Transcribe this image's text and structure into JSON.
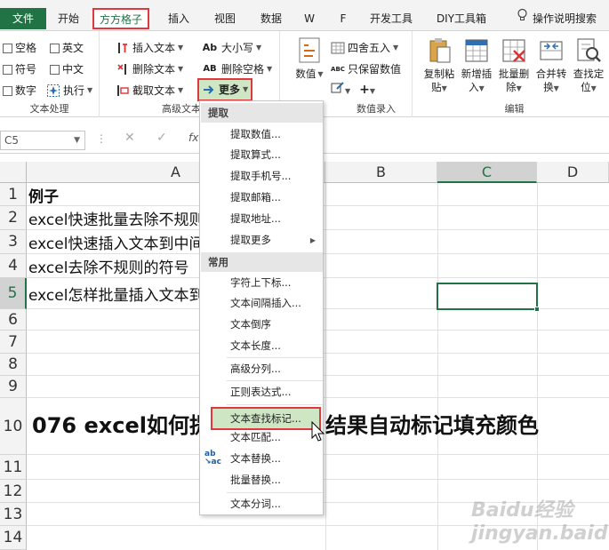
{
  "tabs": [
    "文件",
    "开始",
    "方方格子",
    "插入",
    "视图",
    "数据",
    "W",
    "F",
    "开发工具",
    "DIY工具箱"
  ],
  "tell_me": "操作说明搜索",
  "ribbon": {
    "text_group": {
      "label": "文本处理",
      "items": [
        "空格",
        "英文",
        "符号",
        "中文",
        "数字",
        "执行"
      ]
    },
    "advanced_group": {
      "label": "高级文本",
      "items": [
        "插入文本",
        "删除文本",
        "截取文本",
        "大小写",
        "删除空格",
        "更多"
      ],
      "icons": [
        "Ab",
        "AB"
      ]
    },
    "numeric_group": {
      "label": "数值录入",
      "big_label": "数值",
      "items": [
        "四舍五入",
        "只保留数值"
      ],
      "icon": "ABC"
    },
    "edit_group": {
      "label": "编辑",
      "buttons": [
        {
          "top": "复制粘",
          "bottom": "贴"
        },
        {
          "top": "新增插",
          "bottom": "入"
        },
        {
          "top": "批量删",
          "bottom": "除"
        },
        {
          "top": "合并转",
          "bottom": "换"
        },
        {
          "top": "查找定",
          "bottom": "位"
        }
      ]
    }
  },
  "formula_bar": {
    "name_box": "C5",
    "fx": "fx"
  },
  "columns": [
    "A",
    "B",
    "C",
    "D"
  ],
  "rows": [
    "1",
    "2",
    "3",
    "4",
    "5",
    "6",
    "7",
    "8",
    "9",
    "10",
    "11",
    "12",
    "13",
    "14"
  ],
  "cells": {
    "A1": "例子",
    "A2": "excel快速批量去除不规则",
    "A3": "excel快速插入文本到中间",
    "A4": "excel去除不规则的符号",
    "A5": "excel怎样批量插入文本到",
    "A10_left": "076 excel如何提",
    "A10_right": "结果自动标记填充颜色"
  },
  "menu": {
    "sections": [
      "提取",
      "常用"
    ],
    "extract_items": [
      "提取数值...",
      "提取算式...",
      "提取手机号...",
      "提取邮箱...",
      "提取地址...",
      "提取更多"
    ],
    "common_items": [
      "字符上下标...",
      "文本间隔插入...",
      "文本倒序",
      "文本长度...",
      "高级分列...",
      "正则表达式...",
      "文本查找标记...",
      "文本匹配...",
      "文本替换...",
      "批量替换...",
      "文本分词..."
    ]
  },
  "watermark": "Baidu经验 jingyan.baidu.com",
  "colors": {
    "excel_green": "#217346",
    "highlight_red": "#e0383e",
    "menu_hover": "#cfe6c5"
  }
}
